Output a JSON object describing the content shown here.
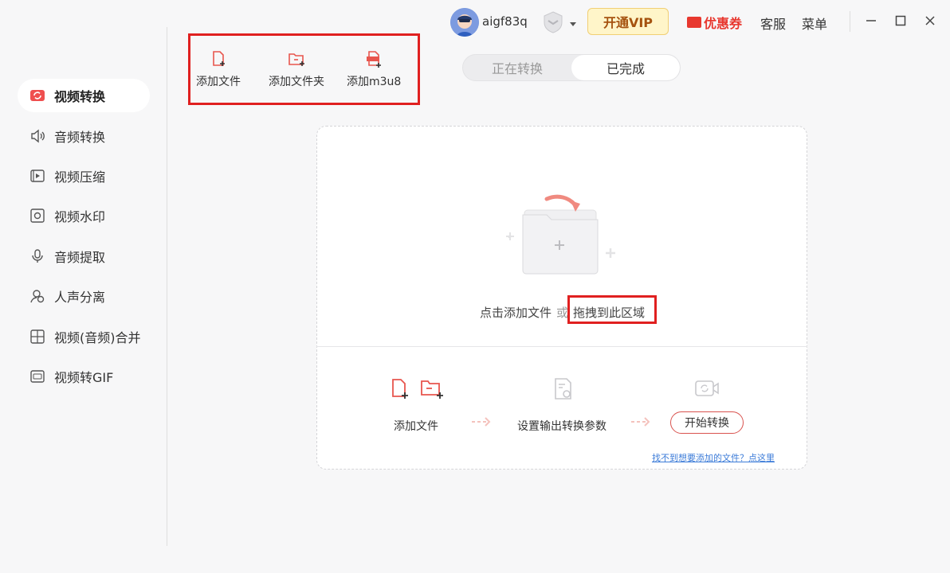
{
  "header": {
    "username": "aigf83q",
    "vip_label": "开通VIP",
    "coupon_label": "优惠券",
    "service_label": "客服",
    "menu_label": "菜单"
  },
  "sidebar": {
    "items": [
      {
        "label": "视频转换",
        "icon": "video-convert-icon",
        "active": true
      },
      {
        "label": "音频转换",
        "icon": "audio-convert-icon"
      },
      {
        "label": "视频压缩",
        "icon": "video-compress-icon"
      },
      {
        "label": "视频水印",
        "icon": "video-watermark-icon"
      },
      {
        "label": "音频提取",
        "icon": "audio-extract-icon"
      },
      {
        "label": "人声分离",
        "icon": "vocal-separate-icon"
      },
      {
        "label": "视频(音频)合并",
        "icon": "merge-icon"
      },
      {
        "label": "视频转GIF",
        "icon": "gif-icon"
      }
    ]
  },
  "toolbar": {
    "add_file": "添加文件",
    "add_folder": "添加文件夹",
    "add_m3u8": "添加m3u8"
  },
  "tabs": {
    "converting": "正在转换",
    "completed": "已完成"
  },
  "dropzone": {
    "hint_click": "点击添加文件",
    "hint_or": "或",
    "hint_drag": "拖拽到此区域",
    "step1": "添加文件",
    "step2": "设置输出转换参数",
    "start_label": "开始转换",
    "help_link": "找不到想要添加的文件？点这里"
  },
  "colors": {
    "accent": "#e8382f",
    "highlight_box": "#e02020",
    "vip_bg": "#fff5c9",
    "link": "#3b7bd8"
  }
}
